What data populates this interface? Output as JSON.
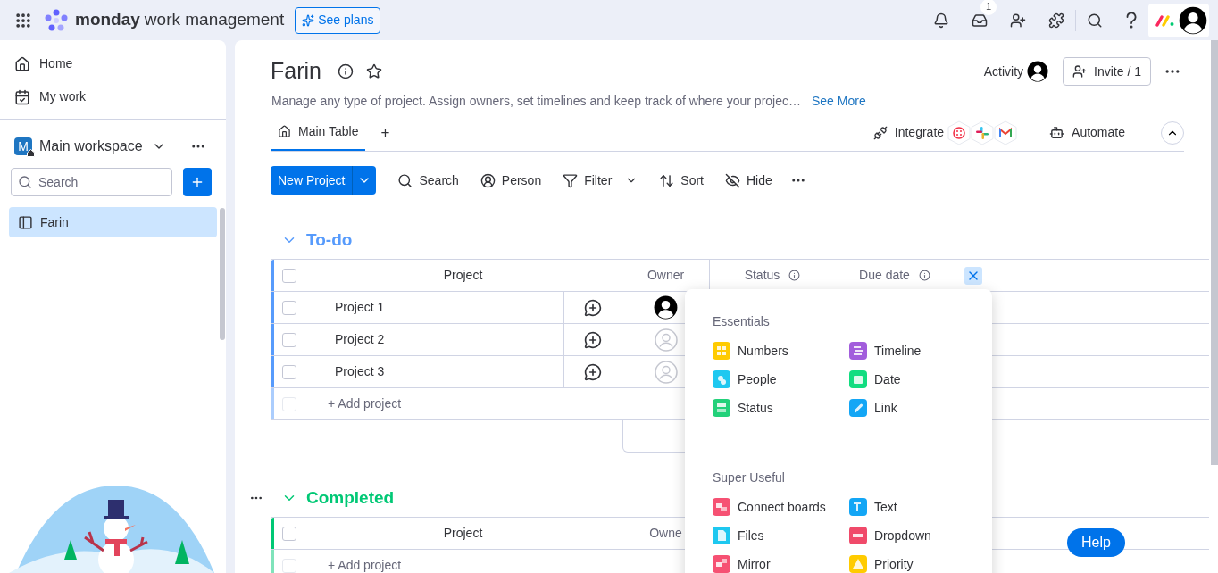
{
  "topbar": {
    "brand": "monday",
    "product": "work management",
    "see_plans": "See plans",
    "inbox_badge": "1"
  },
  "sidebar": {
    "nav": [
      {
        "label": "Home",
        "kind": "home"
      },
      {
        "label": "My work",
        "kind": "mywork"
      }
    ],
    "workspace": {
      "initial": "M",
      "name": "Main workspace"
    },
    "search": {
      "placeholder": "Search"
    },
    "boards": [
      {
        "label": "Farin",
        "selected": true
      }
    ]
  },
  "board": {
    "title": "Farin",
    "description": "Manage any type of project. Assign owners, set timelines and keep track of where your projec…",
    "see_more": "See More",
    "activity": "Activity",
    "invite": "Invite / 1",
    "views": [
      {
        "label": "Main Table",
        "selected": true
      }
    ],
    "add_view": "+",
    "integrate": "Integrate",
    "automate": "Automate",
    "new_project": "New Project",
    "actions": [
      {
        "label": "Search",
        "kind": "search"
      },
      {
        "label": "Person",
        "kind": "person"
      },
      {
        "label": "Filter",
        "kind": "filter"
      },
      {
        "label": "Sort",
        "kind": "sort"
      },
      {
        "label": "Hide",
        "kind": "hide"
      }
    ]
  },
  "groups": [
    {
      "title": "To-do",
      "color": "#579bfc",
      "expanded": true,
      "all_checked": false,
      "add_row_disabled": true,
      "columns": [
        "Project",
        "Owner",
        "Status",
        "Due date"
      ],
      "rows": [
        {
          "name": "Project 1",
          "checked": false,
          "owner_assigned": true
        },
        {
          "name": "Project 2",
          "checked": false,
          "owner_assigned": false
        },
        {
          "name": "Project 3",
          "checked": false,
          "owner_assigned": false
        }
      ],
      "add_label": "+ Add project"
    },
    {
      "title": "Completed",
      "color": "#00c875",
      "expanded": true,
      "all_checked": false,
      "add_row_disabled": true,
      "columns": [
        "Project",
        "Owne"
      ],
      "add_label": "+ Add project"
    }
  ],
  "column_picker": {
    "sections": [
      {
        "title": "Essentials",
        "items": [
          {
            "label": "Numbers",
            "color": "#ffcb00",
            "kind": "numbers"
          },
          {
            "label": "Timeline",
            "color": "#a25ddc",
            "kind": "timeline"
          },
          {
            "label": "People",
            "color": "#1ec8f0",
            "kind": "people"
          },
          {
            "label": "Date",
            "color": "#11dd80",
            "kind": "date"
          },
          {
            "label": "Status",
            "color": "#22d17a",
            "kind": "status"
          },
          {
            "label": "Link",
            "color": "#13a6f5",
            "kind": "link"
          }
        ]
      },
      {
        "title": "Super Useful",
        "items": [
          {
            "label": "Connect boards",
            "color": "#f65173",
            "kind": "connect"
          },
          {
            "label": "Text",
            "color": "#13a6f5",
            "kind": "text"
          },
          {
            "label": "Files",
            "color": "#1ec8f0",
            "kind": "files"
          },
          {
            "label": "Dropdown",
            "color": "#f04a6a",
            "kind": "dropdown"
          },
          {
            "label": "Mirror",
            "color": "#f65173",
            "kind": "mirror"
          },
          {
            "label": "Priority",
            "color": "#ffcb00",
            "kind": "priority"
          }
        ]
      }
    ]
  },
  "help": "Help"
}
